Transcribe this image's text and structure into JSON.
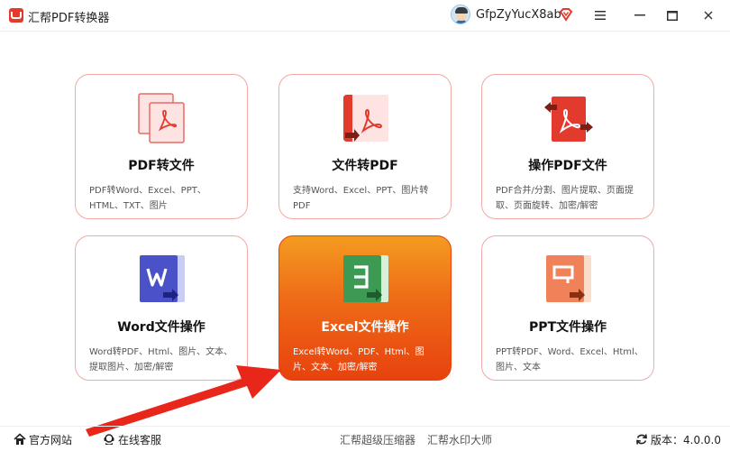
{
  "app": {
    "title": "汇帮PDF转换器",
    "username": "GfpZyYucX8ab",
    "accent": "#e23b2e"
  },
  "window_controls": {
    "menu_icon": "menu-icon",
    "minimize_icon": "minimize-icon",
    "maximize_icon": "maximize-icon",
    "close_icon": "close-icon"
  },
  "cards": [
    {
      "label": "PDF转文件",
      "desc": "PDF转Word、Excel、PPT、HTML、TXT、图片",
      "icon": "pdf-convert-icon"
    },
    {
      "label": "文件转PDF",
      "desc": "支持Word、Excel、PPT、图片转PDF",
      "icon": "file-to-pdf-icon"
    },
    {
      "label": "操作PDF文件",
      "desc": "PDF合并/分割、图片提取、页面提取、页面旋转、加密/解密",
      "icon": "pdf-operate-icon"
    },
    {
      "label": "Word文件操作",
      "desc": "Word转PDF、Html、图片、文本、提取图片、加密/解密",
      "icon": "word-icon"
    },
    {
      "label": "Excel文件操作",
      "desc": "Excel转Word、PDF、Html、图片、文本、加密/解密",
      "icon": "excel-icon",
      "active": true
    },
    {
      "label": "PPT文件操作",
      "desc": "PPT转PDF、Word、Excel、Html、图片、文本",
      "icon": "ppt-icon"
    }
  ],
  "footer": {
    "site": "官方网站",
    "service": "在线客服",
    "compress": "汇帮超级压缩器",
    "watermark": "汇帮水印大师",
    "version": "版本：4.0.0.0"
  }
}
